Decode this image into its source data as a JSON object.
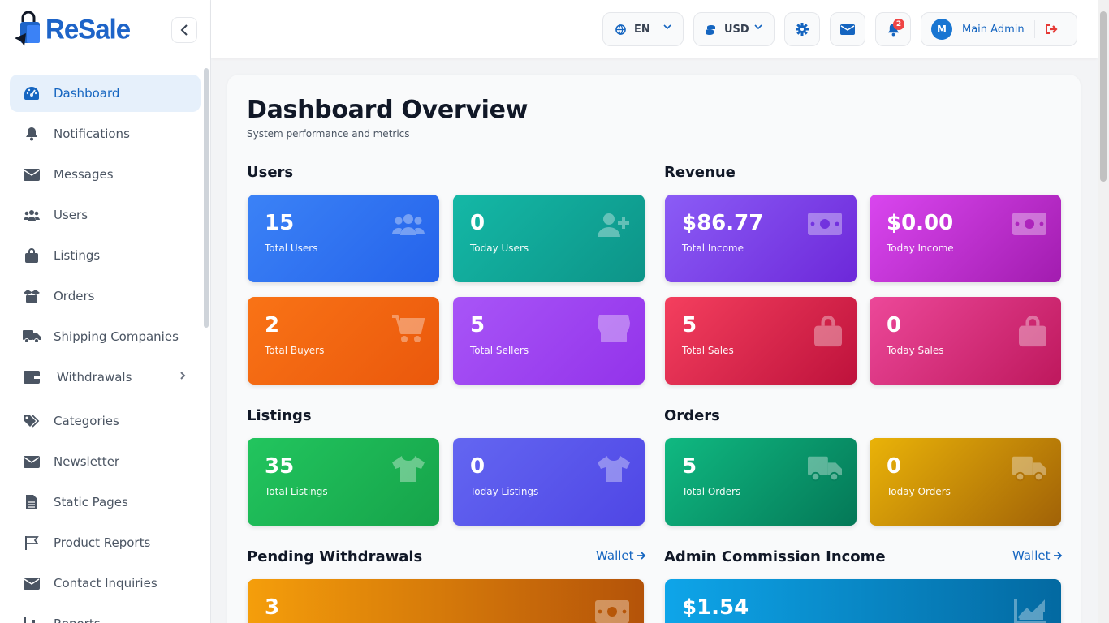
{
  "brand": {
    "name": "ReSale",
    "logo_icon": "shopping-bag-plane-icon"
  },
  "sidebar": {
    "items": [
      {
        "label": "Dashboard",
        "icon": "gauge-icon",
        "active": true
      },
      {
        "label": "Notifications",
        "icon": "bell-icon"
      },
      {
        "label": "Messages",
        "icon": "envelope-icon"
      },
      {
        "label": "Users",
        "icon": "users-icon"
      },
      {
        "label": "Listings",
        "icon": "bag-icon"
      },
      {
        "label": "Orders",
        "icon": "box-icon"
      },
      {
        "label": "Shipping Companies",
        "icon": "truck-icon"
      },
      {
        "label": "Withdrawals",
        "icon": "wallet-icon",
        "expandable": true
      },
      {
        "label": "Categories",
        "icon": "tags-icon"
      },
      {
        "label": "Newsletter",
        "icon": "envelope-icon"
      },
      {
        "label": "Static Pages",
        "icon": "file-icon"
      },
      {
        "label": "Product Reports",
        "icon": "flag-icon"
      },
      {
        "label": "Contact Inquiries",
        "icon": "envelope-icon"
      },
      {
        "label": "Reports",
        "icon": "chart-icon"
      }
    ]
  },
  "topbar": {
    "language": "EN",
    "currency": "USD",
    "notification_count": "2",
    "avatar_initial": "M",
    "admin_name": "Main Admin"
  },
  "page": {
    "title": "Dashboard Overview",
    "subtitle": "System performance and metrics"
  },
  "sections": {
    "users": "Users",
    "revenue": "Revenue",
    "listings": "Listings",
    "orders": "Orders",
    "pending_withdrawals": "Pending Withdrawals",
    "admin_commission": "Admin Commission Income",
    "wallet_link": "Wallet"
  },
  "cards": {
    "total_users": {
      "value": "15",
      "label": "Total Users",
      "icon": "users-icon"
    },
    "today_users": {
      "value": "0",
      "label": "Today Users",
      "icon": "user-plus-icon"
    },
    "total_income": {
      "value": "$86.77",
      "label": "Total Income",
      "icon": "money-bill-icon"
    },
    "today_income": {
      "value": "$0.00",
      "label": "Today Income",
      "icon": "money-bill-icon"
    },
    "total_buyers": {
      "value": "2",
      "label": "Total Buyers",
      "icon": "cart-icon"
    },
    "total_sellers": {
      "value": "5",
      "label": "Total Sellers",
      "icon": "store-icon"
    },
    "total_sales": {
      "value": "5",
      "label": "Total Sales",
      "icon": "bag-icon"
    },
    "today_sales": {
      "value": "0",
      "label": "Today Sales",
      "icon": "bag-icon"
    },
    "total_listings": {
      "value": "35",
      "label": "Total Listings",
      "icon": "shirt-icon"
    },
    "today_listings": {
      "value": "0",
      "label": "Today Listings",
      "icon": "shirt-icon"
    },
    "total_orders": {
      "value": "5",
      "label": "Total Orders",
      "icon": "truck-icon"
    },
    "today_orders": {
      "value": "0",
      "label": "Today Orders",
      "icon": "truck-icon"
    },
    "pending_withdrawals": {
      "value": "3",
      "icon": "money-bill-icon"
    },
    "admin_commission": {
      "value": "$1.54",
      "icon": "chart-line-icon"
    }
  },
  "colors": {
    "accent": "#1565c0",
    "active_bg": "#e6f0fb",
    "logout": "#e53935",
    "badge": "#ef4444"
  }
}
